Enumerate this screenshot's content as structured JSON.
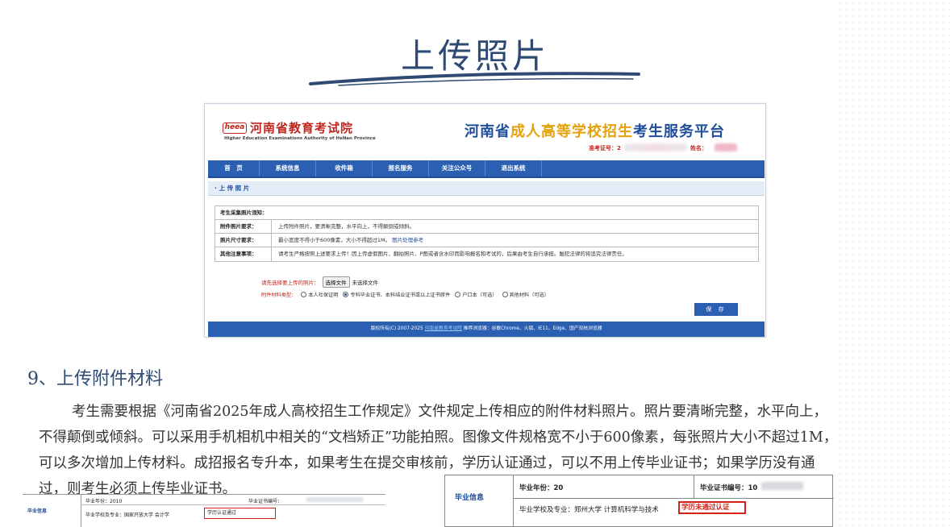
{
  "slide": {
    "title": "上传照片",
    "section_heading": "9、上传附件材料",
    "paragraph": [
      "考生需要根据《河南省2025年成人高校招生工作规定》文件规定上传相应的附件材料照片。照片要清晰完整，水平向上，",
      "不得颠倒或倾斜。可以采用手机相机中相关的“文档矫正”功能拍照。图像文件规格宽不小于600像素，每张照片大小不超过1M，",
      "可以多次增加上传材料。成招报名专升本，如果考生在提交审核前，学历认证通过，可以不用上传毕业证书；如果学历没有通",
      "过，则考生必须上传毕业证书。"
    ]
  },
  "portal": {
    "logo_text": "heea",
    "org_name": "河南省教育考试院",
    "org_name_en": "Higher Education Examinations Authority of HeNan Province",
    "platform_title_pre": "河南省",
    "platform_title_hl": "成人高等学校招生",
    "platform_title_post": "考生服务平台",
    "exam_no_label": "准考证号：2",
    "name_label": "姓名：",
    "nav": [
      "首　页",
      "系统信息",
      "收件箱",
      "报名服务",
      "关注公众号",
      "退出系统"
    ],
    "section_title": "· 上 传 照 片",
    "notice": {
      "title": "考生采集照片须知：",
      "rows": [
        {
          "label": "附件照片要求：",
          "value": "上传附件照片，要清晰完整，水平向上，不得颠倒或倾斜。",
          "link": ""
        },
        {
          "label": "照片尺寸要求：",
          "value": "最小宽度不得小于600像素，大小不得超过1M。",
          "link": "图片处理参考"
        },
        {
          "label": "其他注意事项：",
          "value": "请考生严格按照上述要求上传！因上传虚假图片、翻拍照片、P图或者含水印而影响报名和考试的，后果由考生自行承担。触犯法律的将追究法律责任。",
          "link": ""
        }
      ]
    },
    "upload_label": "请先选择要上传的照片：",
    "choose_file": "选择文件",
    "no_file": "未选择文件",
    "type_label": "附件材料类型：",
    "radio_options": [
      {
        "label": "本人社保证明",
        "checked": false
      },
      {
        "label": "专科毕业证书、本科结业证书或以上证书原件",
        "checked": true
      },
      {
        "label": "户口本（可选）",
        "checked": false
      },
      {
        "label": "其他材料（可选）",
        "checked": false
      }
    ],
    "save_label": "保 存",
    "footer_pre": "版权所有(C) 2007-2025",
    "footer_link": "河南省教育考试院",
    "footer_post": "推荐浏览器：谷歌Chrome、火狐、IE11、Edge、国产双核浏览器"
  },
  "graduation_small": {
    "label": "毕业信息",
    "year": "毕业年份：2010",
    "cert_no": "毕业证书编号：",
    "school": "毕业学校及专业：国家开放大学 会计学",
    "status": "学历认证通过"
  },
  "graduation_large": {
    "label": "毕业信息",
    "year": "毕业年份：20",
    "cert_no": "毕业证书编号：10",
    "school": "毕业学校及专业：郑州大学 计算机科学与技术",
    "status": "学历未通过认证"
  },
  "colors": {
    "title": "#2e4a72",
    "nav_blue": "#2a5fb2",
    "brand_red": "#c0261d",
    "highlight_yellow": "#e3a20a",
    "status_red": "#d6231a"
  }
}
